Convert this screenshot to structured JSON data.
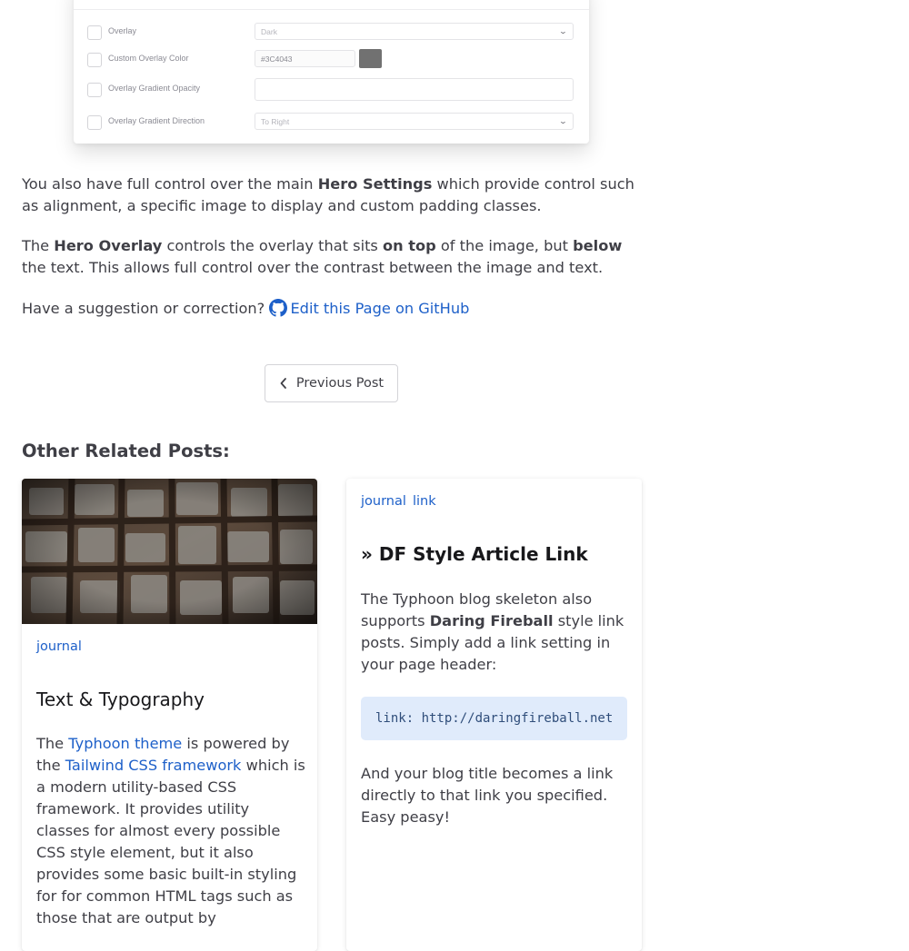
{
  "settings_panel": {
    "rows": [
      {
        "label": "Overlay",
        "value": "Dark",
        "type": "select"
      },
      {
        "label": "Custom Overlay Color",
        "value": "#3C4043",
        "type": "color",
        "swatch_color": "#717171"
      },
      {
        "label": "Overlay Gradient Opacity",
        "value": "",
        "type": "text"
      },
      {
        "label": "Overlay Gradient Direction",
        "value": "To Right",
        "type": "select"
      }
    ]
  },
  "article": {
    "p1": {
      "t1": "You also have full control over the main ",
      "b1": "Hero Settings",
      "t2": " which provide control such as alignment, a specific image to display and custom padding classes."
    },
    "p2": {
      "t1": "The ",
      "b1": "Hero Overlay",
      "t2": " controls the overlay that sits ",
      "b2": "on top",
      "t3": " of the image, but ",
      "b3": "below",
      "t4": " the text. This allows full control over the contrast between the image and text."
    },
    "suggestion_text": "Have a suggestion or correction?",
    "edit_link": "Edit this Page on GitHub"
  },
  "pagination": {
    "previous_label": "Previous Post"
  },
  "related": {
    "heading": "Other Related Posts:",
    "posts": [
      {
        "tags": [
          "journal"
        ],
        "title": "Text & Typography",
        "excerpt": {
          "t1": "The ",
          "link1": "Typhoon theme",
          "t2": " is powered by the ",
          "link2": "Tailwind CSS framework",
          "t3": " which is a modern utility-based CSS framework. It provides utility classes for almost every possible CSS style element, but it also provides some basic built-in styling for for common HTML tags such as those that are output by"
        }
      },
      {
        "tags": [
          "journal",
          "link"
        ],
        "title": "» DF Style Article Link",
        "excerpt": {
          "t1": "The Typhoon blog skeleton also supports ",
          "b1": "Daring Fireball",
          "t2": " style link posts. Simply add a link setting in your page header:"
        },
        "code": "link: http://daringfireball.net",
        "excerpt2": "And your blog title becomes a link directly to that link you specified. Easy peasy!"
      }
    ]
  },
  "colors": {
    "link": "#1e60c9",
    "text": "#3f3f46",
    "code_bg": "#e0ebfb"
  }
}
